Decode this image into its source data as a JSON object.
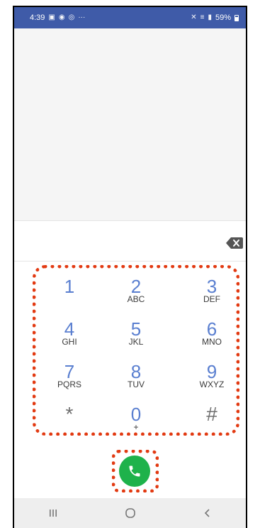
{
  "status_bar": {
    "time": "4:39",
    "battery": "59%",
    "overflow": "···"
  },
  "keypad": {
    "keys": [
      {
        "digit": "1",
        "letters": ""
      },
      {
        "digit": "2",
        "letters": "ABC"
      },
      {
        "digit": "3",
        "letters": "DEF"
      },
      {
        "digit": "4",
        "letters": "GHI"
      },
      {
        "digit": "5",
        "letters": "JKL"
      },
      {
        "digit": "6",
        "letters": "MNO"
      },
      {
        "digit": "7",
        "letters": "PQRS"
      },
      {
        "digit": "8",
        "letters": "TUV"
      },
      {
        "digit": "9",
        "letters": "WXYZ"
      },
      {
        "digit": "*",
        "letters": ""
      },
      {
        "digit": "0",
        "letters": "+"
      },
      {
        "digit": "#",
        "letters": ""
      }
    ]
  },
  "colors": {
    "status_bar_bg": "#3f5ba8",
    "digit": "#5a7fd0",
    "call_button": "#1eb24b",
    "highlight": "#e23a12"
  },
  "icons": {
    "backspace": "backspace-icon",
    "call": "phone-icon",
    "nav_recents": "recents-icon",
    "nav_home": "home-icon",
    "nav_back": "back-icon"
  }
}
